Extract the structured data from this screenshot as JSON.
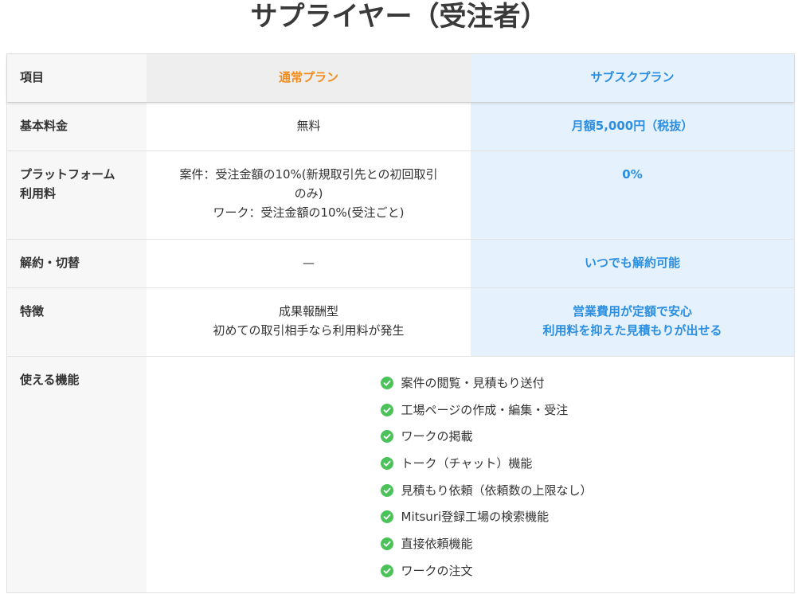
{
  "title": "サプライヤー（受注者）",
  "colors": {
    "normal_plan_accent": "#f28c1b",
    "subscription_accent": "#2b8ee0",
    "subscription_bg": "#e5f2fd",
    "check_green": "#4cc35a"
  },
  "header": {
    "label": "項目",
    "normal": "通常プラン",
    "subscription": "サブスクプラン"
  },
  "rows": [
    {
      "label": [
        "基本料金"
      ],
      "normal": [
        "無料"
      ],
      "subscription": [
        "月額5,000円（税抜）"
      ]
    },
    {
      "label": [
        "プラットフォーム",
        "利用料"
      ],
      "normal": [
        "案件：受注金額の10%(新規取引先との初回取引",
        "のみ)",
        "ワーク：受注金額の10%(受注ごと)"
      ],
      "subscription": [
        "0%"
      ]
    },
    {
      "label": [
        "解約・切替"
      ],
      "normal": [
        "—"
      ],
      "subscription": [
        "いつでも解約可能"
      ]
    },
    {
      "label": [
        "特徴"
      ],
      "normal": [
        "成果報酬型",
        "初めての取引相手なら利用料が発生"
      ],
      "subscription": [
        "営業費用が定額で安心",
        "利用料を抑えた見積もりが出せる"
      ]
    }
  ],
  "features": {
    "label": "使える機能",
    "icon": "check-circle-icon",
    "items": [
      "案件の閲覧・見積もり送付",
      "工場ページの作成・編集・受注",
      "ワークの掲載",
      "トーク（チャット）機能",
      "見積もり依頼（依頼数の上限なし）",
      "Mitsuri登録工場の検索機能",
      "直接依頼機能",
      "ワークの注文"
    ]
  }
}
